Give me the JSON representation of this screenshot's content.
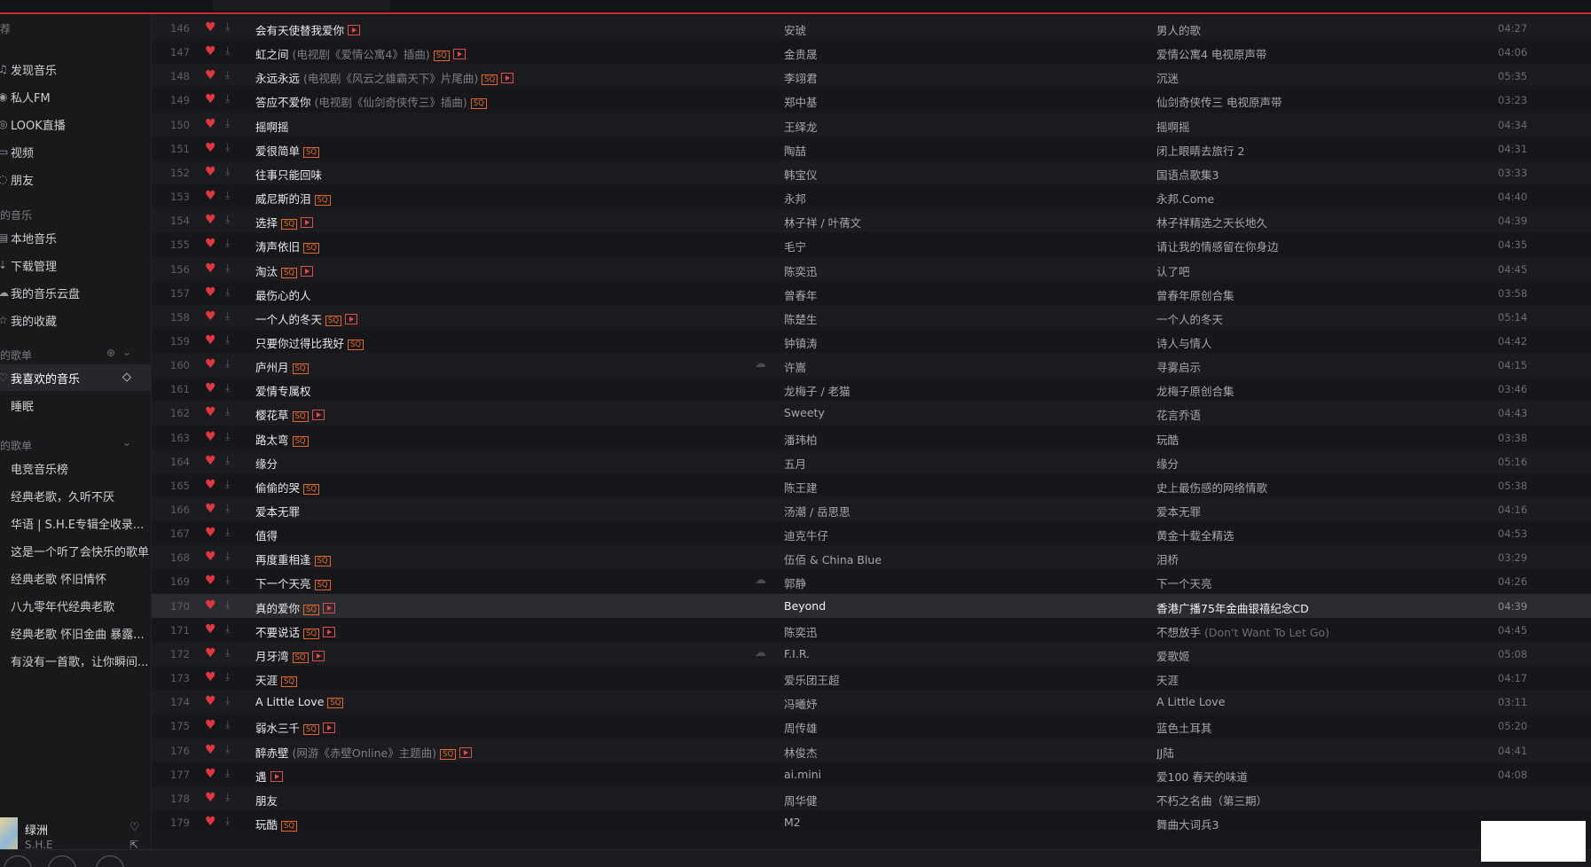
{
  "sidebar": {
    "top_fragment": "荐",
    "items": [
      {
        "icon": "music-note-icon",
        "glyph": "♫",
        "label": "发现音乐"
      },
      {
        "icon": "radio-icon",
        "glyph": "◉",
        "label": "私人FM"
      },
      {
        "icon": "live-icon",
        "glyph": "◎",
        "label": "LOOK直播"
      },
      {
        "icon": "video-icon",
        "glyph": "▭",
        "label": "视频"
      },
      {
        "icon": "friends-icon",
        "glyph": "◌",
        "label": "朋友"
      }
    ],
    "my_music_header": "的音乐",
    "my_music": [
      {
        "icon": "local-music-icon",
        "glyph": "▤",
        "label": "本地音乐"
      },
      {
        "icon": "download-icon",
        "glyph": "⇣",
        "label": "下载管理"
      },
      {
        "icon": "cloud-icon",
        "glyph": "☁",
        "label": "我的音乐云盘"
      },
      {
        "icon": "collect-icon",
        "glyph": "☆",
        "label": "我的收藏"
      }
    ],
    "created_header": "的歌单",
    "created": [
      {
        "icon": "heart-icon",
        "glyph": "♡",
        "label": "我喜欢的音乐",
        "active": true
      },
      {
        "icon": "playlist-icon",
        "glyph": "▏",
        "label": "睡眠"
      }
    ],
    "collected_header": "的歌单",
    "collected": [
      {
        "icon": "playlist-icon",
        "glyph": "▏",
        "label": "电竞音乐榜"
      },
      {
        "icon": "playlist-icon",
        "glyph": "▏",
        "label": "经典老歌，久听不厌"
      },
      {
        "icon": "playlist-icon",
        "glyph": "▏",
        "label": "华语 | S.H.E专辑全收录..."
      },
      {
        "icon": "playlist-icon",
        "glyph": "▏",
        "label": "这是一个听了会快乐的歌单"
      },
      {
        "icon": "playlist-icon",
        "glyph": "▏",
        "label": "经典老歌 怀旧情怀"
      },
      {
        "icon": "playlist-icon",
        "glyph": "▏",
        "label": "八九零年代经典老歌"
      },
      {
        "icon": "playlist-icon",
        "glyph": "▏",
        "label": "经典老歌 怀旧金曲 暴露..."
      },
      {
        "icon": "playlist-icon",
        "glyph": "▏",
        "label": "有没有一首歌，让你瞬间..."
      }
    ]
  },
  "now_playing": {
    "title": "绿洲",
    "artist": "S.H.E"
  },
  "songs": [
    {
      "n": "146",
      "title": "会有天使替我爱你",
      "alias": "",
      "sq": false,
      "mv": true,
      "cloud": false,
      "artist": "安琥",
      "album": "男人的歌",
      "album_alias": "",
      "dur": "04:27"
    },
    {
      "n": "147",
      "title": "虹之间",
      "alias": "(电视剧《爱情公寓4》插曲)",
      "sq": true,
      "mv": true,
      "cloud": false,
      "artist": "金贵晟",
      "album": "爱情公寓4 电视原声带",
      "album_alias": "",
      "dur": "04:06"
    },
    {
      "n": "148",
      "title": "永远永远",
      "alias": "(电视剧《风云之雄霸天下》片尾曲)",
      "sq": true,
      "mv": true,
      "cloud": false,
      "artist": "李翊君",
      "album": "沉迷",
      "album_alias": "",
      "dur": "05:35"
    },
    {
      "n": "149",
      "title": "答应不爱你",
      "alias": "(电视剧《仙剑奇侠传三》插曲)",
      "sq": true,
      "mv": false,
      "cloud": false,
      "artist": "郑中基",
      "album": "仙剑奇侠传三 电视原声带",
      "album_alias": "",
      "dur": "03:23"
    },
    {
      "n": "150",
      "title": "摇啊摇",
      "alias": "",
      "sq": false,
      "mv": false,
      "cloud": false,
      "artist": "王绎龙",
      "album": "摇啊摇",
      "album_alias": "",
      "dur": "04:34"
    },
    {
      "n": "151",
      "title": "爱很简单",
      "alias": "",
      "sq": true,
      "mv": false,
      "cloud": false,
      "artist": "陶喆",
      "album": "闭上眼睛去旅行 2",
      "album_alias": "",
      "dur": "04:31"
    },
    {
      "n": "152",
      "title": "往事只能回味",
      "alias": "",
      "sq": false,
      "mv": false,
      "cloud": false,
      "artist": "韩宝仪",
      "album": "国语点歌集3",
      "album_alias": "",
      "dur": "03:33"
    },
    {
      "n": "153",
      "title": "威尼斯的泪",
      "alias": "",
      "sq": true,
      "mv": false,
      "cloud": false,
      "artist": "永邦",
      "album": "永邦.Come",
      "album_alias": "",
      "dur": "04:40"
    },
    {
      "n": "154",
      "title": "选择",
      "alias": "",
      "sq": true,
      "mv": true,
      "cloud": false,
      "artist": "林子祥 / 叶蒨文",
      "album": "林子祥精选之天长地久",
      "album_alias": "",
      "dur": "04:39"
    },
    {
      "n": "155",
      "title": "涛声依旧",
      "alias": "",
      "sq": true,
      "mv": false,
      "cloud": false,
      "artist": "毛宁",
      "album": "请让我的情感留在你身边",
      "album_alias": "",
      "dur": "04:35"
    },
    {
      "n": "156",
      "title": "淘汰",
      "alias": "",
      "sq": true,
      "mv": true,
      "cloud": false,
      "artist": "陈奕迅",
      "album": "认了吧",
      "album_alias": "",
      "dur": "04:45"
    },
    {
      "n": "157",
      "title": "最伤心的人",
      "alias": "",
      "sq": false,
      "mv": false,
      "cloud": false,
      "artist": "曾春年",
      "album": "曾春年原创合集",
      "album_alias": "",
      "dur": "03:58"
    },
    {
      "n": "158",
      "title": "一个人的冬天",
      "alias": "",
      "sq": true,
      "mv": true,
      "cloud": false,
      "artist": "陈楚生",
      "album": "一个人的冬天",
      "album_alias": "",
      "dur": "05:14"
    },
    {
      "n": "159",
      "title": "只要你过得比我好",
      "alias": "",
      "sq": true,
      "mv": false,
      "cloud": false,
      "artist": "钟镇涛",
      "album": "诗人与情人",
      "album_alias": "",
      "dur": "04:42"
    },
    {
      "n": "160",
      "title": "庐州月",
      "alias": "",
      "sq": true,
      "mv": false,
      "cloud": true,
      "artist": "许嵩",
      "album": "寻雾启示",
      "album_alias": "",
      "dur": "04:15"
    },
    {
      "n": "161",
      "title": "爱情专属权",
      "alias": "",
      "sq": false,
      "mv": false,
      "cloud": false,
      "artist": "龙梅子 / 老猫",
      "album": "龙梅子原创合集",
      "album_alias": "",
      "dur": "03:46"
    },
    {
      "n": "162",
      "title": "樱花草",
      "alias": "",
      "sq": true,
      "mv": true,
      "cloud": false,
      "artist": "Sweety",
      "album": "花言乔语",
      "album_alias": "",
      "dur": "04:43"
    },
    {
      "n": "163",
      "title": "路太弯",
      "alias": "",
      "sq": true,
      "mv": false,
      "cloud": false,
      "artist": "潘玮柏",
      "album": "玩酷",
      "album_alias": "",
      "dur": "03:38"
    },
    {
      "n": "164",
      "title": "缘分",
      "alias": "",
      "sq": false,
      "mv": false,
      "cloud": false,
      "artist": "五月",
      "album": "缘分",
      "album_alias": "",
      "dur": "05:16"
    },
    {
      "n": "165",
      "title": "偷偷的哭",
      "alias": "",
      "sq": true,
      "mv": false,
      "cloud": false,
      "artist": "陈王建",
      "album": "史上最伤感的网络情歌",
      "album_alias": "",
      "dur": "05:38"
    },
    {
      "n": "166",
      "title": "爱本无罪",
      "alias": "",
      "sq": false,
      "mv": false,
      "cloud": false,
      "artist": "汤潮 / 岳思思",
      "album": "爱本无罪",
      "album_alias": "",
      "dur": "04:16"
    },
    {
      "n": "167",
      "title": "值得",
      "alias": "",
      "sq": false,
      "mv": false,
      "cloud": false,
      "artist": "迪克牛仔",
      "album": "黄金十载全精选",
      "album_alias": "",
      "dur": "04:53"
    },
    {
      "n": "168",
      "title": "再度重相逢",
      "alias": "",
      "sq": true,
      "mv": false,
      "cloud": false,
      "artist": "伍佰 & China Blue",
      "album": "泪桥",
      "album_alias": "",
      "dur": "03:29"
    },
    {
      "n": "169",
      "title": "下一个天亮",
      "alias": "",
      "sq": true,
      "mv": false,
      "cloud": true,
      "artist": "郭静",
      "album": "下一个天亮",
      "album_alias": "",
      "dur": "04:26"
    },
    {
      "n": "170",
      "title": "真的爱你",
      "alias": "",
      "sq": true,
      "mv": true,
      "cloud": false,
      "artist": "Beyond",
      "album": "香港广播75年金曲银禧纪念CD",
      "album_alias": "",
      "dur": "04:39",
      "highlight": true
    },
    {
      "n": "171",
      "title": "不要说话",
      "alias": "",
      "sq": true,
      "mv": true,
      "cloud": false,
      "artist": "陈奕迅",
      "album": "不想放手",
      "album_alias": "(Don't Want To Let Go)",
      "dur": "04:45"
    },
    {
      "n": "172",
      "title": "月牙湾",
      "alias": "",
      "sq": true,
      "mv": true,
      "cloud": true,
      "artist": "F.I.R.",
      "album": "爱歌姬",
      "album_alias": "",
      "dur": "05:08"
    },
    {
      "n": "173",
      "title": "天涯",
      "alias": "",
      "sq": true,
      "mv": false,
      "cloud": false,
      "artist": "爱乐团王超",
      "album": "天涯",
      "album_alias": "",
      "dur": "04:17"
    },
    {
      "n": "174",
      "title": "A Little Love",
      "alias": "",
      "sq": true,
      "mv": false,
      "cloud": false,
      "artist": "冯曦妤",
      "album": "A Little Love",
      "album_alias": "",
      "dur": "03:11"
    },
    {
      "n": "175",
      "title": "弱水三千",
      "alias": "",
      "sq": true,
      "mv": true,
      "cloud": false,
      "artist": "周传雄",
      "album": "蓝色土耳其",
      "album_alias": "",
      "dur": "05:20"
    },
    {
      "n": "176",
      "title": "醉赤壁",
      "alias": "(网游《赤壁Online》主题曲)",
      "sq": true,
      "mv": true,
      "cloud": false,
      "artist": "林俊杰",
      "album": "JJ陆",
      "album_alias": "",
      "dur": "04:41"
    },
    {
      "n": "177",
      "title": "遇",
      "alias": "",
      "sq": false,
      "mv": true,
      "cloud": false,
      "artist": "ai.mini",
      "album": "爱100 春天的味道",
      "album_alias": "",
      "dur": "04:08"
    },
    {
      "n": "178",
      "title": "朋友",
      "alias": "",
      "sq": false,
      "mv": false,
      "cloud": false,
      "artist": "周华健",
      "album": "不朽之名曲（第三期）",
      "album_alias": "",
      "dur": ""
    },
    {
      "n": "179",
      "title": "玩酷",
      "alias": "",
      "sq": true,
      "mv": false,
      "cloud": false,
      "artist": "M2",
      "album": "舞曲大词兵3",
      "album_alias": "",
      "dur": ""
    }
  ],
  "badges": {
    "sq": "SQ"
  },
  "colors": {
    "accent": "#c62f2f",
    "heart": "#e0373f",
    "sq_badge": "#e5682b"
  }
}
